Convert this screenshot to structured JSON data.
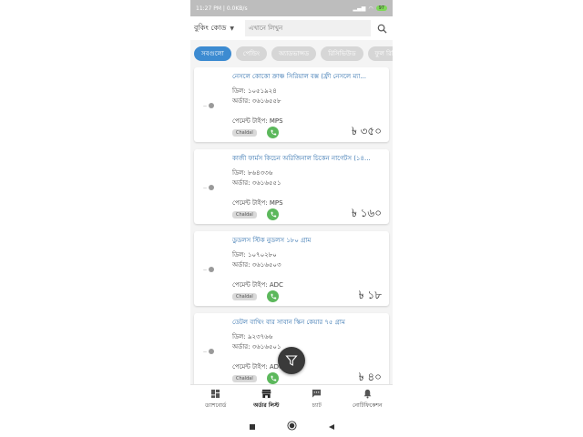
{
  "status": {
    "time": "11:27 PM | 0.0KB/s",
    "battery": "97"
  },
  "search": {
    "code_label": "বুকিং কোড",
    "placeholder": "এখানে লিখুন"
  },
  "filters": [
    "সবগুলো",
    "পেন্ডিং",
    "অ্যাডভান্সড",
    "রিসিভিউড",
    "ফুল রিসিভ"
  ],
  "active_filter": 0,
  "orders": [
    {
      "title": "নেসলে কোকো ক্রাঞ্চ সিরিয়াল বক্স (ফ্রী নেসলে ম্যা...",
      "deal": "ডিল: ১০৫১৯২৪",
      "order": "অর্ডার: ৩৬১৬৫৫৮",
      "payment": "পেমেন্ট টাইপ: MPS",
      "tag": "Chaldal",
      "price": "৳ ৩৫০"
    },
    {
      "title": "কাজী ফার্মস কিচেন অরিজিনাল চিকেন নাগেটস (১৪...",
      "deal": "ডিল: ৮৬৪৩৩৬",
      "order": "অর্ডার: ৩৬১৬৫৫১",
      "payment": "পেমেন্ট টাইপ: MPS",
      "tag": "Chaldal",
      "price": "৳ ১৬০"
    },
    {
      "title": "ডুডলস স্টিক নুডলস ১৮০ গ্রাম",
      "deal": "ডিল: ১০৭০২৮০",
      "order": "অর্ডার: ৩৬১৬৫০৩",
      "payment": "পেমেন্ট টাইপ: ADC",
      "tag": "Chaldal",
      "price": "৳ ১৮"
    },
    {
      "title": "ডেটল বাথিং বার সাবান স্কিন কেয়ার ৭৫ গ্রাম",
      "deal": "ডিল: ৯২৩৭৬৬",
      "order": "অর্ডার: ৩৬১৬৫০১",
      "payment": "পেমেন্ট টাইপ: ADC",
      "tag": "Chaldal",
      "price": "৳ ৪০"
    }
  ],
  "nav": [
    {
      "label": "ড্যাশবোর্ড",
      "icon": "dashboard-icon"
    },
    {
      "label": "অর্ডার লিস্ট",
      "icon": "store-icon"
    },
    {
      "label": "চ্যাট",
      "icon": "chat-icon"
    },
    {
      "label": "নোটিফিকেশন",
      "icon": "bell-icon"
    }
  ],
  "colors": {
    "accent": "#3d8bd1",
    "call": "#5cb85c",
    "title": "#2f6fad"
  }
}
